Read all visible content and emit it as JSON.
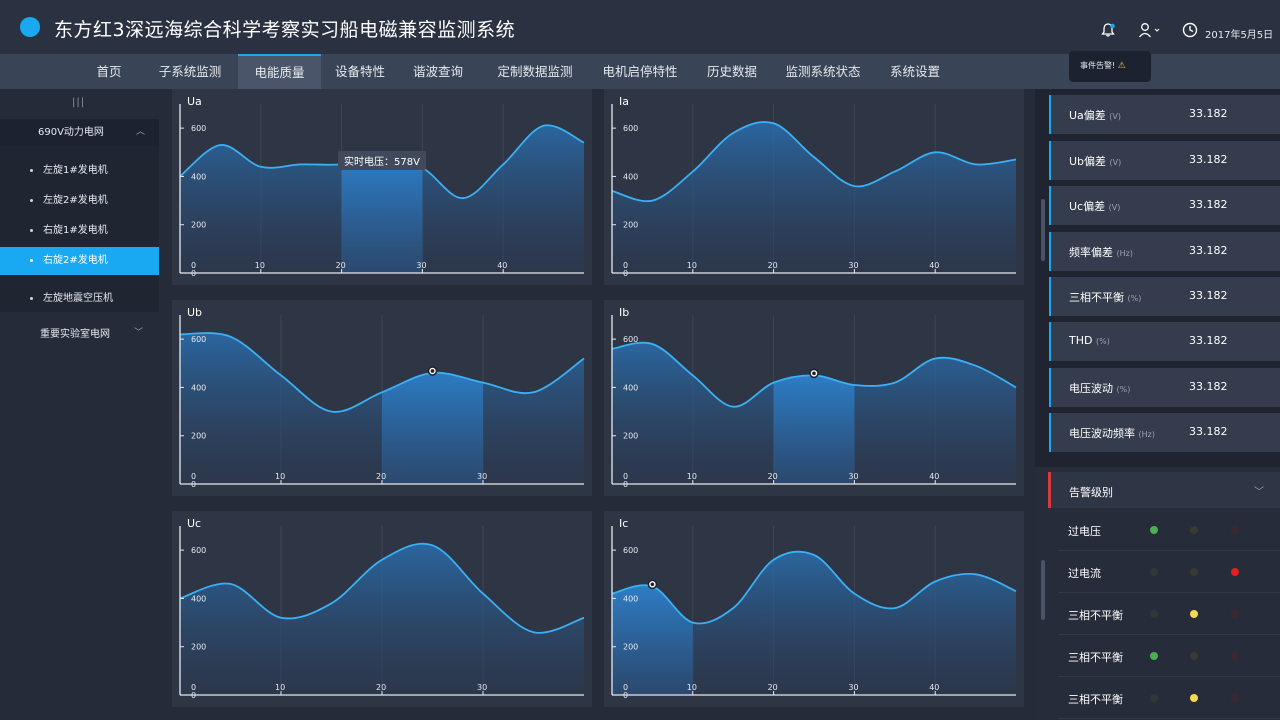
{
  "app": {
    "title": "东方红3深远海综合科学考察实习船电磁兼容监测系统",
    "date": "2017年5月5日",
    "alert_tip": "事件告警!"
  },
  "nav": {
    "items": [
      "首页",
      "子系统监测",
      "电能质量",
      "设备特性",
      "谐波查询",
      "定制数据监测",
      "电机启停特性",
      "历史数据",
      "监测系统状态",
      "系统设置"
    ],
    "active": "电能质量"
  },
  "sidebar": {
    "handle": "|||",
    "group1": "690V动力电网",
    "sub_items": [
      "左旋1#发电机",
      "左旋2#发电机",
      "右旋1#发电机",
      "右旋2#发电机",
      "左旋地震空压机"
    ],
    "active_item": "右旋2#发电机",
    "group2": "重要实验室电网"
  },
  "charts": [
    {
      "title": "Ua",
      "tooltip": "实时电压：578V",
      "chart_data": {
        "type": "area",
        "x": [
          0,
          5,
          10,
          15,
          20,
          25,
          30,
          35,
          40,
          45,
          50
        ],
        "y": [
          400,
          530,
          440,
          450,
          450,
          475,
          435,
          310,
          450,
          610,
          540
        ],
        "x_ticks": [
          "0",
          "10",
          "20",
          "30",
          "40"
        ],
        "y_ticks": [
          "0",
          "200",
          "400",
          "600"
        ],
        "ylim": [
          0,
          700
        ],
        "highlight_x_range": [
          20,
          30
        ],
        "marker_x": 25
      }
    },
    {
      "title": "Ia",
      "chart_data": {
        "type": "area",
        "x": [
          0,
          5,
          10,
          15,
          20,
          25,
          30,
          35,
          40,
          45,
          50
        ],
        "y": [
          340,
          300,
          420,
          580,
          620,
          480,
          360,
          420,
          500,
          450,
          470
        ],
        "x_ticks": [
          "0",
          "10",
          "20",
          "30",
          "40"
        ],
        "y_ticks": [
          "0",
          "200",
          "400",
          "600"
        ],
        "ylim": [
          0,
          700
        ]
      }
    },
    {
      "title": "Ub",
      "chart_data": {
        "type": "area",
        "x": [
          0,
          5,
          10,
          15,
          20,
          25,
          30,
          35,
          40
        ],
        "y": [
          620,
          610,
          450,
          300,
          380,
          460,
          420,
          380,
          520
        ],
        "x_ticks": [
          "0",
          "10",
          "20",
          "30"
        ],
        "y_ticks": [
          "0",
          "200",
          "400",
          "600"
        ],
        "ylim": [
          0,
          700
        ],
        "highlight_x_range": [
          20,
          30
        ],
        "marker_x": 25
      }
    },
    {
      "title": "Ib",
      "chart_data": {
        "type": "area",
        "x": [
          0,
          5,
          10,
          15,
          20,
          25,
          30,
          35,
          40,
          45,
          50
        ],
        "y": [
          560,
          580,
          450,
          320,
          420,
          450,
          410,
          420,
          520,
          490,
          400
        ],
        "x_ticks": [
          "0",
          "10",
          "20",
          "30",
          "40"
        ],
        "y_ticks": [
          "0",
          "200",
          "400",
          "600"
        ],
        "ylim": [
          0,
          700
        ],
        "highlight_x_range": [
          20,
          30
        ],
        "marker_x": 25
      }
    },
    {
      "title": "Uc",
      "chart_data": {
        "type": "area",
        "x": [
          0,
          5,
          10,
          15,
          20,
          25,
          30,
          35,
          40
        ],
        "y": [
          400,
          460,
          320,
          380,
          560,
          620,
          420,
          260,
          320
        ],
        "x_ticks": [
          "0",
          "10",
          "20",
          "30"
        ],
        "y_ticks": [
          "0",
          "200",
          "400",
          "600"
        ],
        "ylim": [
          0,
          700
        ]
      }
    },
    {
      "title": "Ic",
      "chart_data": {
        "type": "area",
        "x": [
          0,
          5,
          10,
          15,
          20,
          25,
          30,
          35,
          40,
          45,
          50
        ],
        "y": [
          420,
          450,
          300,
          360,
          560,
          580,
          420,
          360,
          470,
          500,
          430
        ],
        "x_ticks": [
          "0",
          "10",
          "20",
          "30",
          "40"
        ],
        "y_ticks": [
          "0",
          "200",
          "400",
          "600"
        ],
        "ylim": [
          0,
          700
        ],
        "highlight_x_range": [
          0,
          10
        ],
        "marker_x": 5
      }
    }
  ],
  "metrics": [
    {
      "label": "Ua偏差",
      "unit": "(V)",
      "value": "33.182"
    },
    {
      "label": "Ub偏差",
      "unit": "(V)",
      "value": "33.182"
    },
    {
      "label": "Uc偏差",
      "unit": "(V)",
      "value": "33.182"
    },
    {
      "label": "频率偏差",
      "unit": "(Hz)",
      "value": "33.182"
    },
    {
      "label": "三相不平衡",
      "unit": "(%)",
      "value": "33.182"
    },
    {
      "label": "THD",
      "unit": "(%)",
      "value": "33.182"
    },
    {
      "label": "电压波动",
      "unit": "(%)",
      "value": "33.182"
    },
    {
      "label": "电压波动频率",
      "unit": "(Hz)",
      "value": "33.182"
    }
  ],
  "alarm": {
    "title": "告警级别",
    "rows": [
      {
        "label": "过电压",
        "active": "green"
      },
      {
        "label": "过电流",
        "active": "red"
      },
      {
        "label": "三相不平衡",
        "active": "yellow"
      },
      {
        "label": "三相不平衡",
        "active": "green"
      },
      {
        "label": "三相不平衡",
        "active": "yellow"
      }
    ],
    "colors": {
      "green": "#4caf50",
      "yellow": "#f7d94c",
      "red": "#e32020",
      "off_green": "#2f3a36",
      "off_yellow": "#3a3a34",
      "off_red": "#3a2a30"
    }
  },
  "colors": {
    "accent": "#19a8f2",
    "line": "#3ab0f5"
  }
}
